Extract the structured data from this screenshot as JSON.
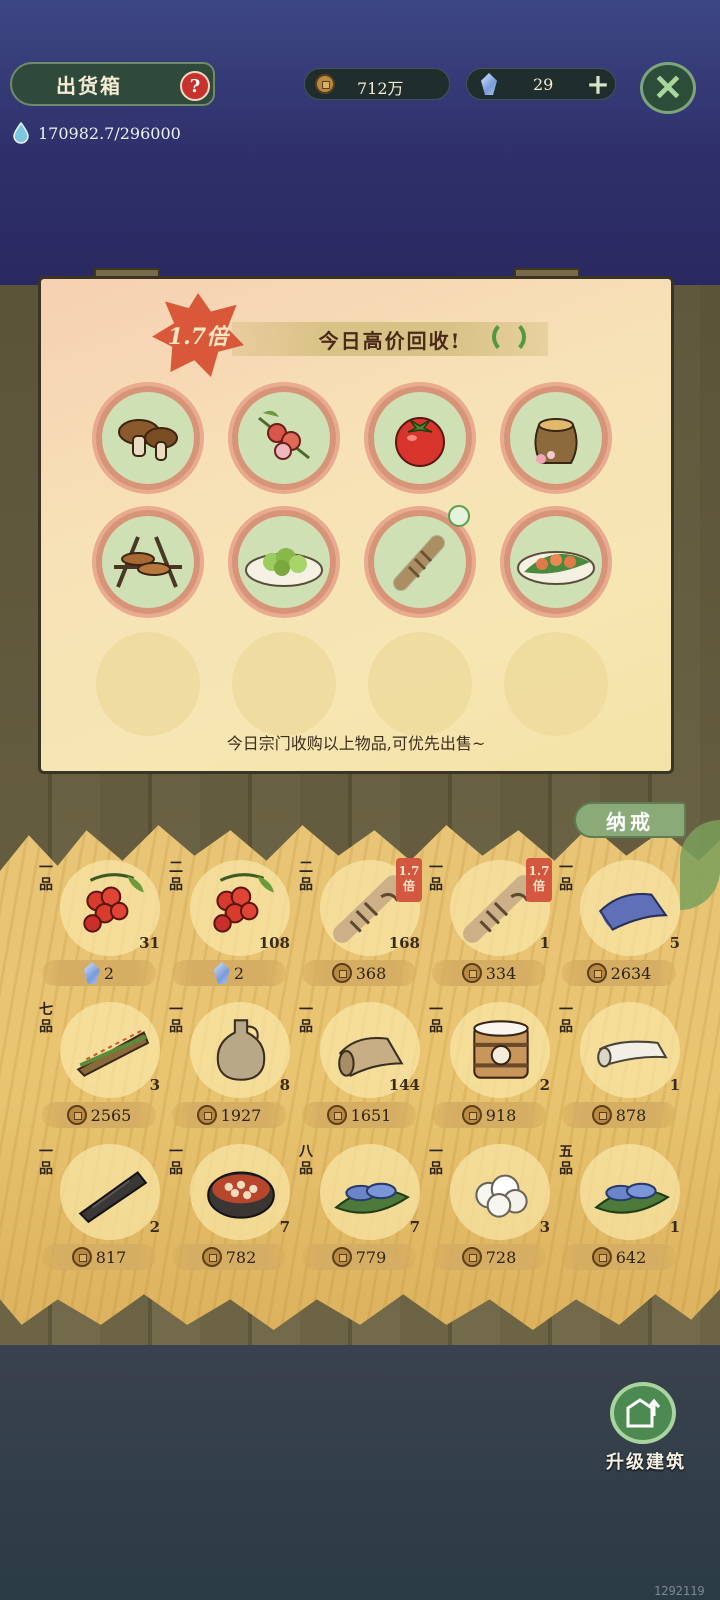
{
  "header": {
    "title": "出货箱",
    "help_symbol": "?",
    "water": "170982.7/296000",
    "coins": "712万",
    "gems": "29",
    "plus": "+",
    "close": "✕"
  },
  "notice": {
    "multiplier": "1.7倍",
    "banner": "今日高价回收!",
    "footer": "今日宗门收购以上物品,可优先出售~",
    "slots": [
      {
        "icon": "mushroom-icon"
      },
      {
        "icon": "berry-branch-icon"
      },
      {
        "icon": "tomato-icon"
      },
      {
        "icon": "pottery-jar-icon"
      },
      {
        "icon": "grilled-skewer-icon"
      },
      {
        "icon": "vegetable-dish-icon"
      },
      {
        "icon": "twine-bundle-icon"
      },
      {
        "icon": "sliced-dish-icon"
      }
    ]
  },
  "inventory": {
    "tab_label": "纳戒",
    "items": [
      {
        "grade": "一品",
        "count": "31",
        "price": "2",
        "currency": "gem",
        "icon": "red-berries-icon",
        "mult": ""
      },
      {
        "grade": "二品",
        "count": "108",
        "price": "2",
        "currency": "gem",
        "icon": "red-berries-icon",
        "mult": ""
      },
      {
        "grade": "二品",
        "count": "168",
        "price": "368",
        "currency": "coin",
        "icon": "rope-bundle-icon",
        "mult": "1.7倍"
      },
      {
        "grade": "一品",
        "count": "1",
        "price": "334",
        "currency": "coin",
        "icon": "rope-bundle-icon",
        "mult": "1.7倍"
      },
      {
        "grade": "一品",
        "count": "5",
        "price": "2634",
        "currency": "coin",
        "icon": "blue-cloth-icon",
        "mult": ""
      },
      {
        "grade": "七品",
        "count": "3",
        "price": "2565",
        "currency": "coin",
        "icon": "grass-bundle-icon",
        "mult": ""
      },
      {
        "grade": "一品",
        "count": "8",
        "price": "1927",
        "currency": "coin",
        "icon": "clay-pot-icon",
        "mult": ""
      },
      {
        "grade": "一品",
        "count": "144",
        "price": "1651",
        "currency": "coin",
        "icon": "paper-roll-icon",
        "mult": ""
      },
      {
        "grade": "一品",
        "count": "2",
        "price": "918",
        "currency": "coin",
        "icon": "milk-bucket-icon",
        "mult": ""
      },
      {
        "grade": "一品",
        "count": "1",
        "price": "878",
        "currency": "coin",
        "icon": "white-cloth-icon",
        "mult": ""
      },
      {
        "grade": "一品",
        "count": "2",
        "price": "817",
        "currency": "coin",
        "icon": "charcoal-log-icon",
        "mult": ""
      },
      {
        "grade": "一品",
        "count": "7",
        "price": "782",
        "currency": "coin",
        "icon": "beans-bowl-icon",
        "mult": ""
      },
      {
        "grade": "八品",
        "count": "7",
        "price": "779",
        "currency": "coin",
        "icon": "blue-shrimp-icon",
        "mult": ""
      },
      {
        "grade": "一品",
        "count": "3",
        "price": "728",
        "currency": "coin",
        "icon": "cotton-icon",
        "mult": ""
      },
      {
        "grade": "五品",
        "count": "1",
        "price": "642",
        "currency": "coin",
        "icon": "blue-shrimp-icon",
        "mult": ""
      }
    ]
  },
  "footer": {
    "upgrade_label": "升级建筑",
    "id_text": "1292119"
  },
  "colors": {
    "accent_red": "#d4573f",
    "coin": "#b98b42",
    "straw": "#e8c476",
    "upgrade_green": "#4d8a52"
  }
}
